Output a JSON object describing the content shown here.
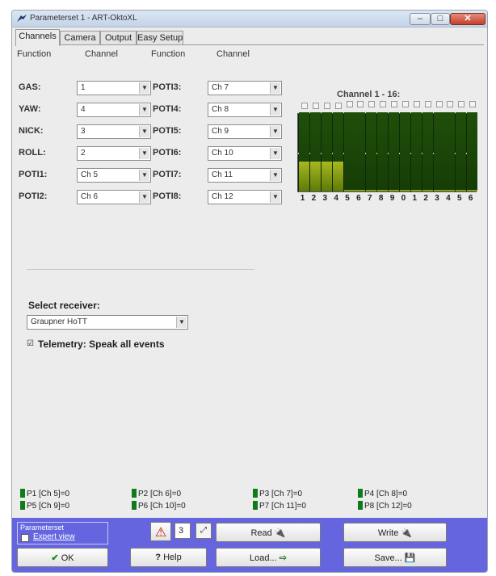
{
  "window": {
    "title": "Parameterset 1 - ART-OktoXL",
    "minimize": "–",
    "maximize": "□",
    "close": "✕"
  },
  "tabs": [
    "Channels",
    "Camera",
    "Output",
    "Easy Setup"
  ],
  "columns": {
    "function": "Function",
    "channel": "Channel"
  },
  "left_rows": [
    {
      "label": "GAS:",
      "value": "1"
    },
    {
      "label": "YAW:",
      "value": "4"
    },
    {
      "label": "NICK:",
      "value": "3"
    },
    {
      "label": "ROLL:",
      "value": "2"
    },
    {
      "label": "POTI1:",
      "value": "Ch 5"
    },
    {
      "label": "POTI2:",
      "value": "Ch 6"
    }
  ],
  "right_rows": [
    {
      "label": "POTI3:",
      "value": "Ch 7"
    },
    {
      "label": "POTI4:",
      "value": "Ch 8"
    },
    {
      "label": "POTI5:",
      "value": "Ch 9"
    },
    {
      "label": "POTI6:",
      "value": "Ch 10"
    },
    {
      "label": "POTI7:",
      "value": "Ch 11"
    },
    {
      "label": "POTI8:",
      "value": "Ch 12"
    }
  ],
  "channel_monitor": {
    "title": "Channel 1 - 16:",
    "bar_levels": [
      0.38,
      0.38,
      0.38,
      0.38,
      0.02,
      0.02,
      0.02,
      0.02,
      0.02,
      0.02,
      0.02,
      0.02,
      0.02,
      0.02,
      0.02,
      0.02
    ],
    "bar_colors": {
      "active_top": "#a8b820",
      "active_bottom": "#5c7a08",
      "idle": "#1f4f0a",
      "idle_dark": "#163c06"
    },
    "labels": [
      "1",
      "2",
      "3",
      "4",
      "5",
      "6",
      "7",
      "8",
      "9",
      "0",
      "1",
      "2",
      "3",
      "4",
      "5",
      "6"
    ]
  },
  "receiver": {
    "label": "Select receiver:",
    "value": "Graupner HoTT"
  },
  "telemetry": {
    "checked_glyph": "☑",
    "label": "Telemetry: Speak all events"
  },
  "poti_status": [
    "P1 [Ch 5]=0",
    "P2 [Ch 6]=0",
    "P3 [Ch 7]=0",
    "P4 [Ch 8]=0",
    "P5 [Ch 9]=0",
    "P6 [Ch 10]=0",
    "P7 [Ch 11]=0",
    "P8 [Ch 12]=0"
  ],
  "bottom": {
    "group_title": "Parameterset",
    "expert_view": "Expert view",
    "warn_glyph": "⚠",
    "param_number": "3",
    "scale_glyph": "⤢",
    "read": "Read",
    "write": "Write",
    "ok": "OK",
    "help": "Help",
    "load": "Load...",
    "save": "Save...",
    "ok_glyph": "✔",
    "help_glyph": "?",
    "read_glyph": "🔌",
    "write_glyph": "🔌",
    "load_glyph": "⇨",
    "save_glyph": "💾"
  }
}
